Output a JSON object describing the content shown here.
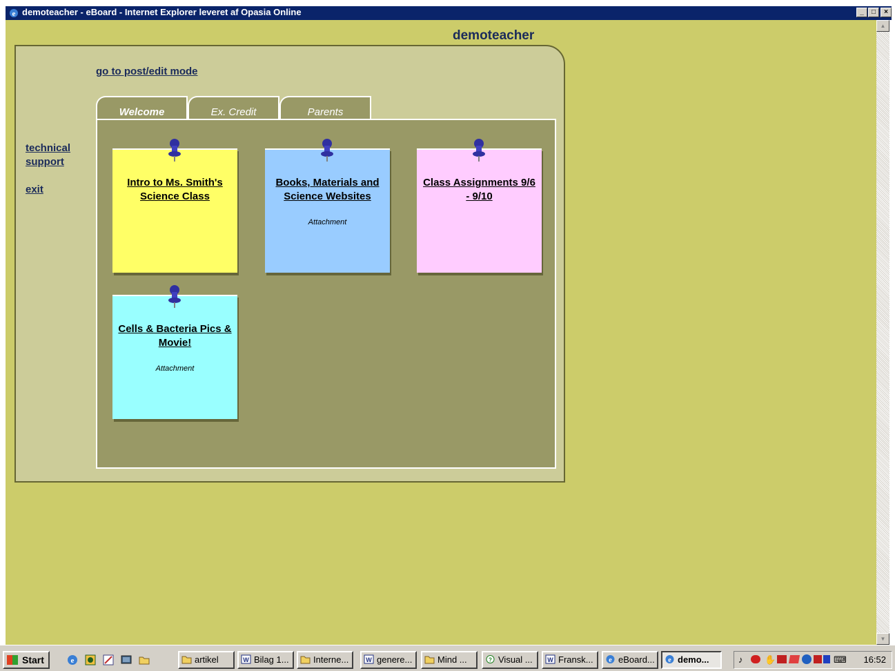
{
  "window": {
    "title": "demoteacher - eBoard - Internet Explorer leveret af Opasia Online",
    "buttons": {
      "minimize": "_",
      "maximize": "□",
      "close": "×"
    }
  },
  "page": {
    "username": "demoteacher",
    "post_link": "go to post/edit mode",
    "side_links": {
      "technical": "technical",
      "support": "support",
      "exit": "exit"
    },
    "tabs": [
      {
        "label": "Welcome",
        "active": true
      },
      {
        "label": "Ex. Credit",
        "active": false
      },
      {
        "label": "Parents",
        "active": false
      }
    ],
    "notes": [
      {
        "title": "Intro to Ms. Smith's Science Class",
        "attachment": "",
        "color": "#ffff66"
      },
      {
        "title": "Books, Materials and Science Websites",
        "attachment": "Attachment",
        "color": "#99ccff"
      },
      {
        "title": "Class Assignments 9/6 - 9/10",
        "attachment": "",
        "color": "#ffccff"
      },
      {
        "title": "Cells & Bacteria Pics & Movie!",
        "attachment": "Attachment",
        "color": "#99ffff"
      }
    ]
  },
  "taskbar": {
    "start": "Start",
    "buttons": [
      {
        "label": "artikel",
        "icon": "folder-icon"
      },
      {
        "label": "Bilag 1...",
        "icon": "word-icon"
      },
      {
        "label": "Interne...",
        "icon": "folder-icon"
      },
      {
        "label": "genere...",
        "icon": "word-icon"
      },
      {
        "label": "Mind ...",
        "icon": "folder-icon"
      },
      {
        "label": "Visual ...",
        "icon": "app-icon"
      },
      {
        "label": "Fransk...",
        "icon": "word-icon"
      },
      {
        "label": "eBoard...",
        "icon": "ie-icon"
      },
      {
        "label": "demo...",
        "icon": "ie-icon",
        "active": true
      }
    ],
    "clock": "16:52"
  }
}
